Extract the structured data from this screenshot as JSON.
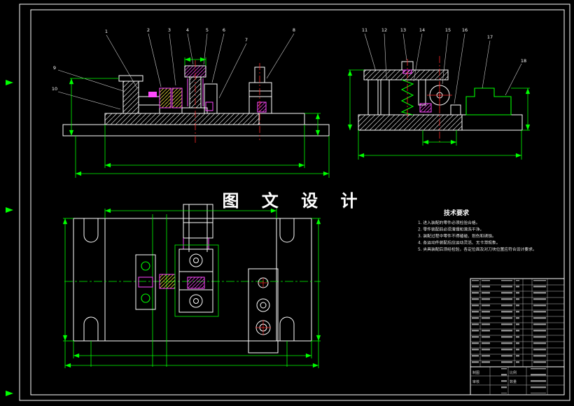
{
  "watermark": {
    "text": "图 文 设 计"
  },
  "tech_requirements": {
    "heading": "技术要求",
    "notes": [
      "1. 进入装配的零件必须检验合格。",
      "2. 零件装配前必须清理和清洗干净。",
      "3. 装配过程中零件不得磕碰、划伤和锈蚀。",
      "4. 各运动件装配后应运动灵活、无卡滞现象。",
      "5. 夹具装配后须经检验，各定位面及对刀块位置应符合设计要求。"
    ]
  },
  "callouts": {
    "front": [
      "1",
      "2",
      "3",
      "4",
      "5",
      "6",
      "7",
      "8",
      "9",
      "10"
    ],
    "side": [
      "11",
      "12",
      "13",
      "14",
      "15",
      "16",
      "17",
      "18"
    ]
  },
  "title_block": {
    "labels": {
      "draft": "制图",
      "review": "审核",
      "scale": "比例",
      "qty": "数量"
    }
  },
  "colors": {
    "background": "#000000",
    "geometry": "#ffffff",
    "dimensions": "#00ff00",
    "details": "#ff49ff",
    "inserts": "#e6d83a",
    "centerlines": "#ff2a2a",
    "frame": "#e8e8e8"
  }
}
